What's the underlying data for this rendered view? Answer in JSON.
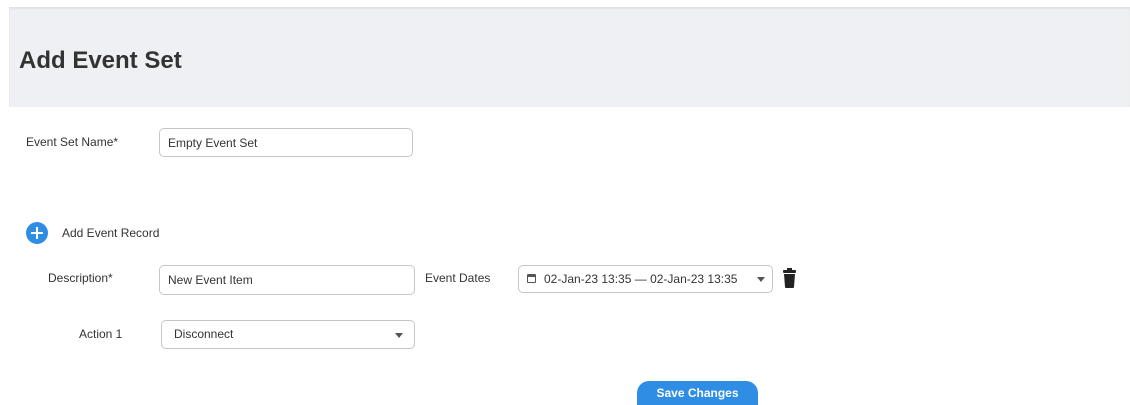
{
  "header": {
    "title": "Add Event Set"
  },
  "event_set": {
    "name_label": "Event Set Name*",
    "name_value": "Empty Event Set"
  },
  "add_record": {
    "label": "Add Event Record",
    "icon": "plus-circle-icon"
  },
  "record": {
    "description_label": "Description*",
    "description_value": "New Event Item",
    "dates_label": "Event Dates",
    "dates_value": "02-Jan-23 13:35 — 02-Jan-23 13:35",
    "calendar_icon": "calendar-icon",
    "delete_icon": "trash-icon"
  },
  "action": {
    "label": "Action 1",
    "selected": "Disconnect"
  },
  "save_button": {
    "label": "Save Changes"
  },
  "colors": {
    "accent": "#2f8de4",
    "header_bg": "#eef0f3",
    "border": "#c6c6c6",
    "text": "#333333"
  }
}
